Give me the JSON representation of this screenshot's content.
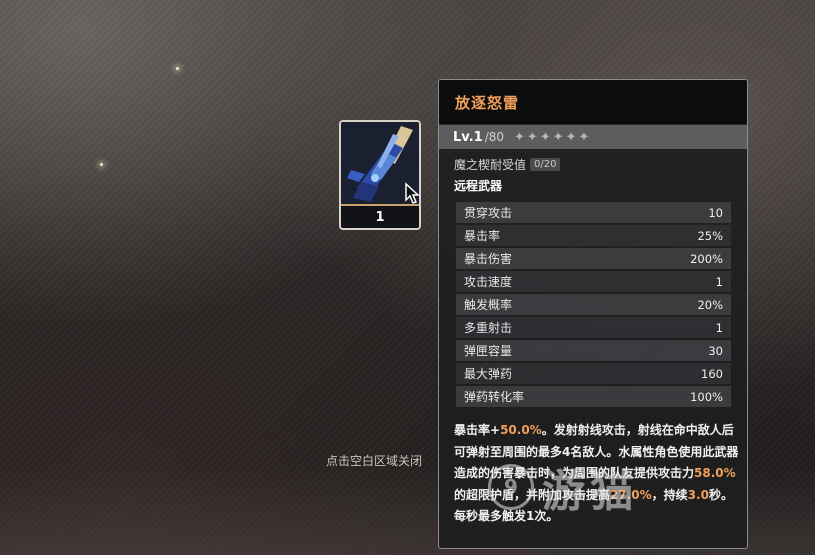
{
  "weapon": {
    "name": "放逐怒雷",
    "level": "Lv.1",
    "level_max": "/80",
    "stars": [
      "✦",
      "✦",
      "✦",
      "✦",
      "✦",
      "✦"
    ],
    "durability_label": "魔之楔耐受值",
    "durability_value": "0/20",
    "type": "远程武器",
    "count": "1"
  },
  "stats": [
    {
      "label": "贯穿攻击",
      "value": "10"
    },
    {
      "label": "暴击率",
      "value": "25%"
    },
    {
      "label": "暴击伤害",
      "value": "200%"
    },
    {
      "label": "攻击速度",
      "value": "1"
    },
    {
      "label": "触发概率",
      "value": "20%"
    },
    {
      "label": "多重射击",
      "value": "1"
    },
    {
      "label": "弹匣容量",
      "value": "30"
    },
    {
      "label": "最大弹药",
      "value": "160"
    },
    {
      "label": "弹药转化率",
      "value": "100%"
    }
  ],
  "description": {
    "p1": "暴击率+",
    "v1": "50.0%",
    "p2": "。发射射线攻击，射线在命中敌人后可弹射至周围的最多4名敌人。水属性角色使用此武器造成的伤害暴击时，为周围的队友提供攻击力",
    "v2": "58.0%",
    "p3": "的超限护盾，并附加攻击提高",
    "v3": "27.0%",
    "p4": "，持续",
    "v4": "3.0",
    "p5": "秒。每秒最多触发1次。"
  },
  "close_hint": "点击空白区域关闭",
  "watermark": {
    "circle": "9",
    "text": "游猫"
  },
  "colors": {
    "accent": "#f0a05a",
    "card_border": "#d8d3c6",
    "level_bar": "#5d5d60"
  }
}
